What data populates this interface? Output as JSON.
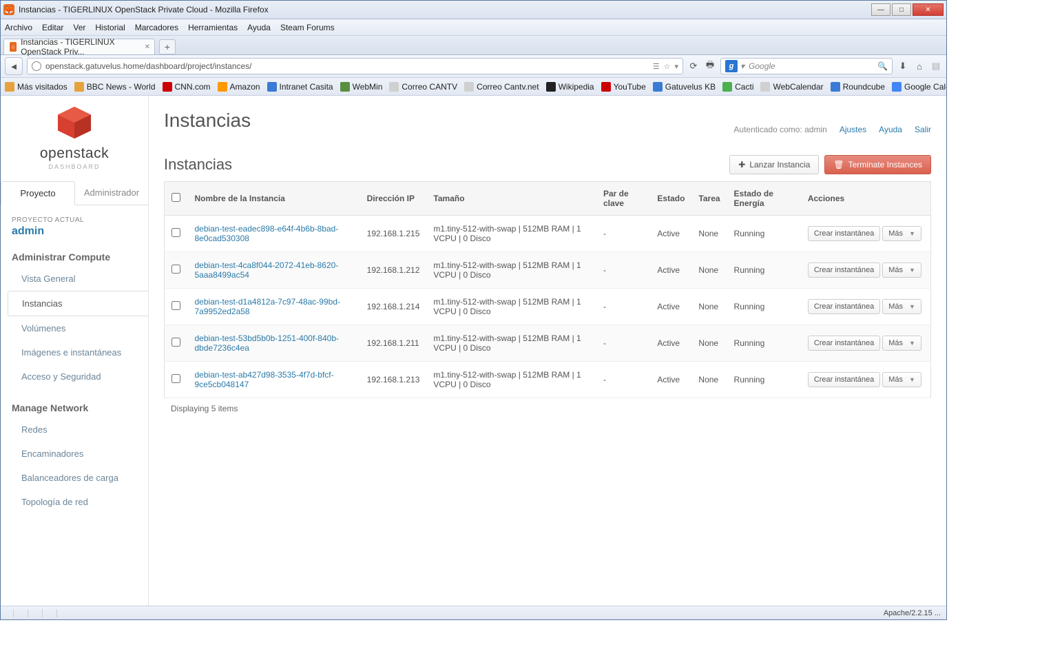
{
  "window": {
    "title": "Instancias - TIGERLINUX OpenStack Private Cloud - Mozilla Firefox"
  },
  "menubar": [
    "Archivo",
    "Editar",
    "Ver",
    "Historial",
    "Marcadores",
    "Herramientas",
    "Ayuda",
    "Steam Forums"
  ],
  "tab": {
    "title": "Instancias - TIGERLINUX OpenStack Priv..."
  },
  "address": "openstack.gatuvelus.home/dashboard/project/instances/",
  "search_placeholder": "Google",
  "bookmarks": [
    {
      "label": "Más visitados",
      "color": "#e6a23c"
    },
    {
      "label": "BBC News - World",
      "color": "#e6a23c"
    },
    {
      "label": "CNN.com",
      "color": "#cc0000"
    },
    {
      "label": "Amazon",
      "color": "#ff9900"
    },
    {
      "label": "Intranet Casita",
      "color": "#3a7bd5"
    },
    {
      "label": "WebMin",
      "color": "#5a8f3d"
    },
    {
      "label": "Correo CANTV",
      "color": "#d0d0d0"
    },
    {
      "label": "Correo Cantv.net",
      "color": "#d0d0d0"
    },
    {
      "label": "Wikipedia",
      "color": "#222"
    },
    {
      "label": "YouTube",
      "color": "#cc0000"
    },
    {
      "label": "Gatuvelus KB",
      "color": "#3a7bd5"
    },
    {
      "label": "Cacti",
      "color": "#4caf50"
    },
    {
      "label": "WebCalendar",
      "color": "#d0d0d0"
    },
    {
      "label": "Roundcube",
      "color": "#3a7bd5"
    },
    {
      "label": "Google Calendar",
      "color": "#4285f4"
    }
  ],
  "logo": {
    "brand": "openstack",
    "sub": "DASHBOARD"
  },
  "side_tabs": {
    "project": "Proyecto",
    "admin": "Administrador"
  },
  "project_label": "PROYECTO ACTUAL",
  "project_name": "admin",
  "section_compute": "Administrar Compute",
  "compute_items": [
    "Vista General",
    "Instancias",
    "Volúmenes",
    "Imágenes e instantáneas",
    "Acceso y Seguridad"
  ],
  "section_network": "Manage Network",
  "network_items": [
    "Redes",
    "Encaminadores",
    "Balanceadores de carga",
    "Topología de red"
  ],
  "auth_text": "Autenticado como: admin",
  "toplinks": {
    "ajustes": "Ajustes",
    "ayuda": "Ayuda",
    "salir": "Salir"
  },
  "page_title": "Instancias",
  "panel_title": "Instancias",
  "btn_launch": "Lanzar Instancia",
  "btn_terminate": "Terminate Instances",
  "columns": {
    "name": "Nombre de la Instancia",
    "ip": "Dirección IP",
    "size": "Tamaño",
    "keypair": "Par de clave",
    "state": "Estado",
    "task": "Tarea",
    "power": "Estado de Energía",
    "actions": "Acciones"
  },
  "rows": [
    {
      "name": "debian-test-eadec898-e64f-4b6b-8bad-8e0cad530308",
      "ip": "192.168.1.215",
      "size": "m1.tiny-512-with-swap | 512MB RAM | 1 VCPU | 0 Disco",
      "keypair": "-",
      "state": "Active",
      "task": "None",
      "power": "Running"
    },
    {
      "name": "debian-test-4ca8f044-2072-41eb-8620-5aaa8499ac54",
      "ip": "192.168.1.212",
      "size": "m1.tiny-512-with-swap | 512MB RAM | 1 VCPU | 0 Disco",
      "keypair": "-",
      "state": "Active",
      "task": "None",
      "power": "Running"
    },
    {
      "name": "debian-test-d1a4812a-7c97-48ac-99bd-7a9952ed2a58",
      "ip": "192.168.1.214",
      "size": "m1.tiny-512-with-swap | 512MB RAM | 1 VCPU | 0 Disco",
      "keypair": "-",
      "state": "Active",
      "task": "None",
      "power": "Running"
    },
    {
      "name": "debian-test-53bd5b0b-1251-400f-840b-dbde7236c4ea",
      "ip": "192.168.1.211",
      "size": "m1.tiny-512-with-swap | 512MB RAM | 1 VCPU | 0 Disco",
      "keypair": "-",
      "state": "Active",
      "task": "None",
      "power": "Running"
    },
    {
      "name": "debian-test-ab427d98-3535-4f7d-bfcf-9ce5cb048147",
      "ip": "192.168.1.213",
      "size": "m1.tiny-512-with-swap | 512MB RAM | 1 VCPU | 0 Disco",
      "keypair": "-",
      "state": "Active",
      "task": "None",
      "power": "Running"
    }
  ],
  "row_action_snapshot": "Crear instantánea",
  "row_action_more": "Más",
  "table_footer": "Displaying 5 items",
  "statusbar": "Apache/2.2.15 ..."
}
